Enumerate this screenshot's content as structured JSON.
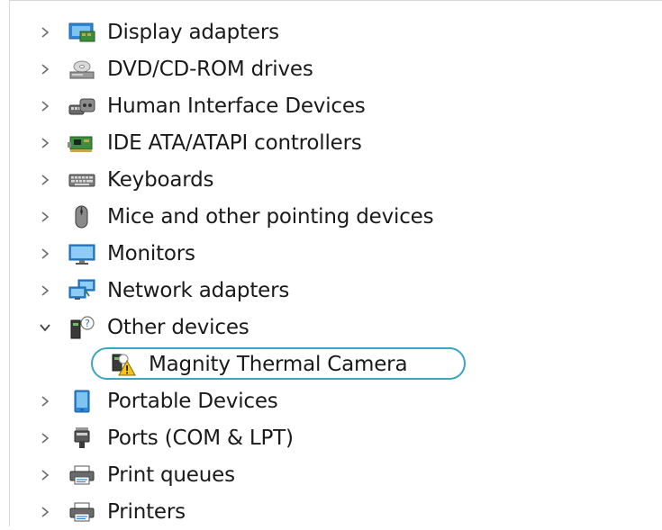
{
  "tree": {
    "items": [
      {
        "label": "Display adapters",
        "icon": "display-adapter-icon",
        "expanded": false
      },
      {
        "label": "DVD/CD-ROM drives",
        "icon": "dvd-drive-icon",
        "expanded": false
      },
      {
        "label": "Human Interface Devices",
        "icon": "hid-icon",
        "expanded": false
      },
      {
        "label": "IDE ATA/ATAPI controllers",
        "icon": "ide-controller-icon",
        "expanded": false
      },
      {
        "label": "Keyboards",
        "icon": "keyboard-icon",
        "expanded": false
      },
      {
        "label": "Mice and other pointing devices",
        "icon": "mouse-icon",
        "expanded": false
      },
      {
        "label": "Monitors",
        "icon": "monitor-icon",
        "expanded": false
      },
      {
        "label": "Network adapters",
        "icon": "network-adapter-icon",
        "expanded": false
      },
      {
        "label": "Other devices",
        "icon": "unknown-device-icon",
        "expanded": true
      },
      {
        "label": "Magnity Thermal Camera",
        "icon": "warning-device-icon",
        "child": true,
        "highlighted": true
      },
      {
        "label": "Portable Devices",
        "icon": "portable-device-icon",
        "expanded": false
      },
      {
        "label": "Ports (COM & LPT)",
        "icon": "port-icon",
        "expanded": false
      },
      {
        "label": "Print queues",
        "icon": "printer-icon",
        "expanded": false
      },
      {
        "label": "Printers",
        "icon": "printer-icon",
        "expanded": false
      }
    ]
  },
  "colors": {
    "highlight_ring": "#3aa6c4",
    "chevron": "#6d6d6d",
    "text": "#1a1a1a"
  }
}
